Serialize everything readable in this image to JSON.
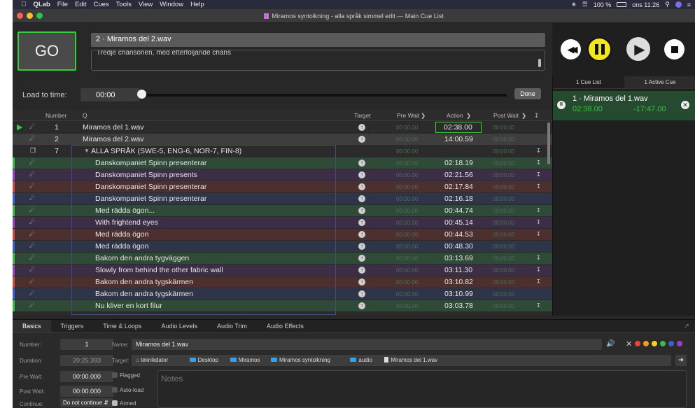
{
  "menubar": {
    "app": "QLab",
    "items": [
      "File",
      "Edit",
      "Cues",
      "Tools",
      "View",
      "Window",
      "Help"
    ],
    "battery": "100 %",
    "clock": "ons 11:26"
  },
  "window": {
    "title": "Miramos syntolkning - alla språk simmel edit — Main Cue List"
  },
  "go_label": "GO",
  "standby": {
    "name": "2 · Miramos del 2.wav",
    "notes": "Tredje chansonen, med efterföljande chans"
  },
  "load_to_time": {
    "label": "Load to time:",
    "value": "00:00",
    "done": "Done"
  },
  "columns": {
    "number": "Number",
    "q": "Q",
    "target": "Target",
    "prewait": "Pre Wait",
    "action": "Action",
    "postwait": "Post Wait"
  },
  "placeholder_time": "00:00.00",
  "rows": [
    {
      "number": "1",
      "name": "Miramos del 1.wav",
      "action": "02:38.00",
      "color": "#2b2b2b",
      "bar": ""
    },
    {
      "number": "2",
      "name": "Miramos del 2.wav",
      "action": "14:00.59",
      "color": "#3e3e3e",
      "bar": ""
    },
    {
      "number": "7",
      "name": "ALLA SPRÅK (SWE-5, ENG-6, NOR-7, FIN-8)",
      "action": "",
      "color": "#2b2b2b",
      "bar": ""
    },
    {
      "number": "",
      "name": "Danskompaniet Spinn presenterar",
      "action": "02:18.19",
      "color": "#2f4a36",
      "bar": "#3bbd45"
    },
    {
      "number": "",
      "name": "Danskompaniet Spinn presents",
      "action": "02:21.56",
      "color": "#3c2e47",
      "bar": "#9b3fc7"
    },
    {
      "number": "",
      "name": "Danskompaniet Spinn presenterar",
      "action": "02:17.84",
      "color": "#4c3030",
      "bar": "#d64a3a"
    },
    {
      "number": "",
      "name": "Danskompaniet Spinn presenterar",
      "action": "02:16.18",
      "color": "#2e3548",
      "bar": "#3b5fcf"
    },
    {
      "number": "",
      "name": "Med rädda ögon...",
      "action": "00:44.74",
      "color": "#2f4a36",
      "bar": "#3bbd45"
    },
    {
      "number": "",
      "name": "With frightend eyes",
      "action": "00:45.14",
      "color": "#3c2e47",
      "bar": "#9b3fc7"
    },
    {
      "number": "",
      "name": "Med rädda ögon",
      "action": "00:44.53",
      "color": "#4c3030",
      "bar": "#d64a3a"
    },
    {
      "number": "",
      "name": "Med rädda ögon",
      "action": "00:48.30",
      "color": "#2e3548",
      "bar": "#3b5fcf"
    },
    {
      "number": "",
      "name": "Bakom den andra tygväggen",
      "action": "03:13.69",
      "color": "#2f4a36",
      "bar": "#3bbd45"
    },
    {
      "number": "",
      "name": "Slowly from behind the other fabric wall",
      "action": "03:11.30",
      "color": "#3c2e47",
      "bar": "#9b3fc7"
    },
    {
      "number": "",
      "name": "Bakom den andra tygskärmen",
      "action": "03:10.82",
      "color": "#4c3030",
      "bar": "#d64a3a"
    },
    {
      "number": "",
      "name": "Bakom den andra tygskärmen",
      "action": "03:10.99",
      "color": "#2e3548",
      "bar": "#3b5fcf"
    },
    {
      "number": "",
      "name": "Nu kliver en kort filur",
      "action": "03:03.78",
      "color": "#2f4a36",
      "bar": "#3bbd45"
    }
  ],
  "sidebar": {
    "tab_cue_list": "1 Cue List",
    "tab_active": "1 Active Cue",
    "active_name": "1 · Miramos del 1.wav",
    "active_elapsed": "02:38.00",
    "active_remaining": "-17:47.00"
  },
  "inspector_tabs": [
    "Basics",
    "Triggers",
    "Time & Loops",
    "Audio Levels",
    "Audio Trim",
    "Audio Effects"
  ],
  "inspector": {
    "number_label": "Number:",
    "number": "1",
    "name_label": "Name:",
    "name": "Miramos del 1.wav",
    "duration_label": "Duration:",
    "duration": "20:25.393",
    "target_label": "Target:",
    "target_path": [
      "teknikdator",
      "Desktop",
      "Miramos",
      "Miramos syntolkning",
      "audio",
      "Miramos del 1.wav"
    ],
    "prewait_label": "Pre Wait:",
    "prewait": "00:00.000",
    "postwait_label": "Post Wait:",
    "postwait": "00:00.000",
    "continue_label": "Continue:",
    "continue": "Do not continue",
    "flagged": "Flagged",
    "autoload": "Auto-load",
    "armed": "Armed",
    "notes_placeholder": "Notes",
    "colors": [
      "#e8463a",
      "#f29a1d",
      "#f2d21d",
      "#3bbd45",
      "#3b5fcf",
      "#9b3fc7"
    ]
  }
}
